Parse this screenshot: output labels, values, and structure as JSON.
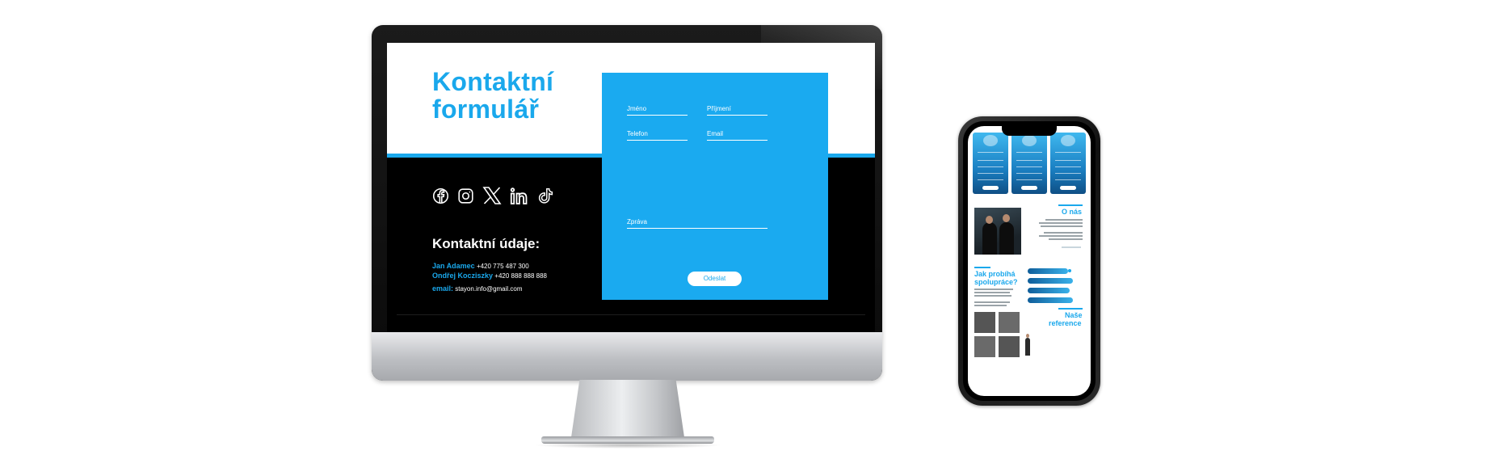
{
  "desktop": {
    "title_line1": "Kontaktní",
    "title_line2": "formulář",
    "social_icons": [
      "facebook-icon",
      "instagram-icon",
      "x-icon",
      "linkedin-icon",
      "tiktok-icon"
    ],
    "contact_heading": "Kontaktní údaje:",
    "contacts": [
      {
        "name": "Jan Adamec",
        "phone": "+420 775 487 300"
      },
      {
        "name": "Ondřej Kocziszky",
        "phone": "+420 888 888 888"
      }
    ],
    "email_label": "email:",
    "email_value": "stayon.info@gmail.com",
    "form": {
      "first_name": "Jméno",
      "last_name": "Příjmení",
      "phone": "Telefon",
      "email": "Email",
      "message": "Zpráva",
      "submit": "Odeslat"
    }
  },
  "mobile": {
    "about_heading": "O nás",
    "process_heading_line1": "Jak probíhá",
    "process_heading_line2": "spolupráce?",
    "references_heading_line1": "Naše",
    "references_heading_line2": "reference"
  },
  "colors": {
    "accent": "#1aa8ec",
    "form_bg": "#1aaaf0",
    "screen_dark": "#000000"
  }
}
